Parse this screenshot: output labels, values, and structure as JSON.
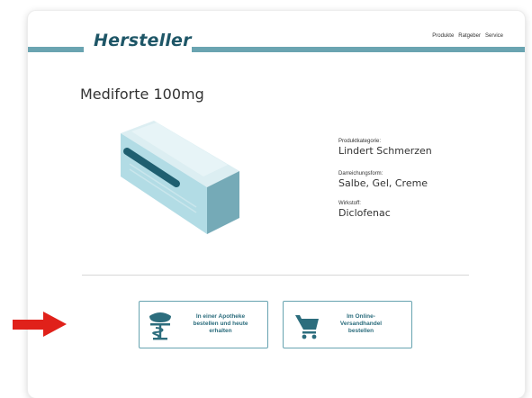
{
  "header": {
    "logo_text": "Hersteller",
    "nav": [
      "Produkte",
      "Ratgeber",
      "Service"
    ]
  },
  "product": {
    "name": "Mediforte 100mg",
    "attributes": [
      {
        "label": "Produktkategorie:",
        "value": "Lindert Schmerzen"
      },
      {
        "label": "Darreichungsform:",
        "value": "Salbe, Gel, Creme"
      },
      {
        "label": "Wirkstoff:",
        "value": "Diclofenac"
      }
    ]
  },
  "actions": {
    "pharmacy": {
      "line1": "In einer Apotheke",
      "line2": "bestellen und heute",
      "line3": "erhalten",
      "icon": "pharmacy-icon"
    },
    "online": {
      "line1": "Im Online-",
      "line2": "Versandhandel",
      "line3": "bestellen",
      "icon": "shopping-cart-icon"
    }
  },
  "colors": {
    "accent": "#6aa4b1",
    "brand": "#1e5667",
    "highlight_arrow": "#e0211a"
  }
}
